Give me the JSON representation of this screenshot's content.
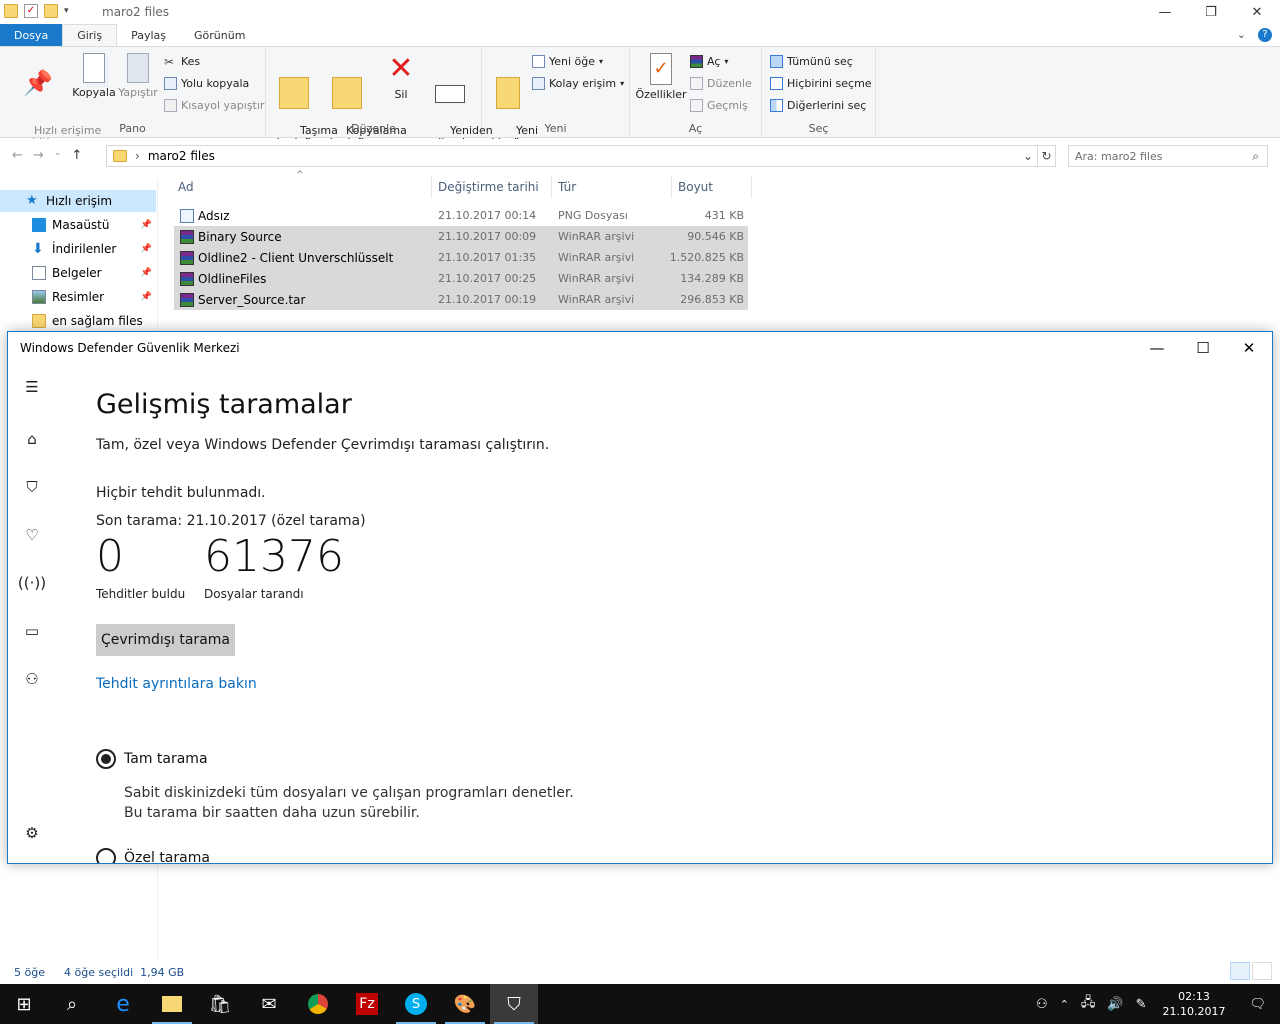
{
  "explorer": {
    "title": "maro2 files",
    "tabs": {
      "dosya": "Dosya",
      "giris": "Giriş",
      "paylas": "Paylaş",
      "gorunum": "Görünüm"
    },
    "ribbon": {
      "pano": {
        "label": "Pano",
        "pin": "Hızlı erişime\nsabitle",
        "copy": "Kopyala",
        "paste": "Yapıştır",
        "cut": "Kes",
        "copy_path": "Yolu kopyala",
        "paste_shortcut": "Kısayol yapıştır"
      },
      "duzenle": {
        "label": "Düzenle",
        "move_to": "Taşıma\nhedefi",
        "copy_to": "Kopyalama\nhedefi",
        "delete": "Sil",
        "rename": "Yeniden\nadlandır"
      },
      "yeni": {
        "label": "Yeni",
        "new_folder": "Yeni\nklasör",
        "new_item": "Yeni öğe",
        "easy_access": "Kolay erişim"
      },
      "ac": {
        "label": "Aç",
        "properties": "Özellikler",
        "open": "Aç",
        "edit": "Düzenle",
        "history": "Geçmiş"
      },
      "sec": {
        "label": "Seç",
        "select_all": "Tümünü seç",
        "select_none": "Hiçbirini seçme",
        "invert": "Diğerlerini seç"
      }
    },
    "address": {
      "path": "maro2 files",
      "search_placeholder": "Ara: maro2 files"
    },
    "nav": [
      {
        "label": "Hızlı erişim"
      },
      {
        "label": "Masaüstü"
      },
      {
        "label": "İndirilenler"
      },
      {
        "label": "Belgeler"
      },
      {
        "label": "Resimler"
      },
      {
        "label": "en sağlam files"
      }
    ],
    "columns": {
      "name": "Ad",
      "date": "Değiştirme tarihi",
      "type": "Tür",
      "size": "Boyut"
    },
    "files": [
      {
        "name": "Adsız",
        "date": "21.10.2017 00:14",
        "type": "PNG Dosyası",
        "size": "431 KB"
      },
      {
        "name": "Binary Source",
        "date": "21.10.2017 00:09",
        "type": "WinRAR arşivi",
        "size": "90.546 KB"
      },
      {
        "name": "Oldline2 - Client Unverschlüsselt",
        "date": "21.10.2017 01:35",
        "type": "WinRAR arşivi",
        "size": "1.520.825 KB"
      },
      {
        "name": "OldlineFiles",
        "date": "21.10.2017 00:25",
        "type": "WinRAR arşivi",
        "size": "134.289 KB"
      },
      {
        "name": "Server_Source.tar",
        "date": "21.10.2017 00:19",
        "type": "WinRAR arşivi",
        "size": "296.853 KB"
      }
    ],
    "status": {
      "count": "5 öğe",
      "selected": "4 öğe seçildi  1,94 GB"
    }
  },
  "defender": {
    "title": "Windows Defender Güvenlik Merkezi",
    "heading": "Gelişmiş taramalar",
    "intro": "Tam, özel veya Windows Defender Çevrimdışı taraması çalıştırın.",
    "no_threats": "Hiçbir tehdit bulunmadı.",
    "last_scan": "Son tarama: 21.10.2017 (özel tarama)",
    "threats_count": "0",
    "threats_label": "Tehditler buldu",
    "files_count": "61376",
    "files_label": "Dosyalar tarandı",
    "offline_button": "Çevrimdışı tarama",
    "details_link": "Tehdit ayrıntılara bakın",
    "full_scan": "Tam tarama",
    "full_scan_desc": "Sabit diskinizdeki tüm dosyaları ve çalışan programları denetler. Bu tarama bir saatten daha uzun sürebilir.",
    "custom_scan": "Özel tarama"
  },
  "taskbar": {
    "time": "02:13",
    "date": "21.10.2017"
  }
}
